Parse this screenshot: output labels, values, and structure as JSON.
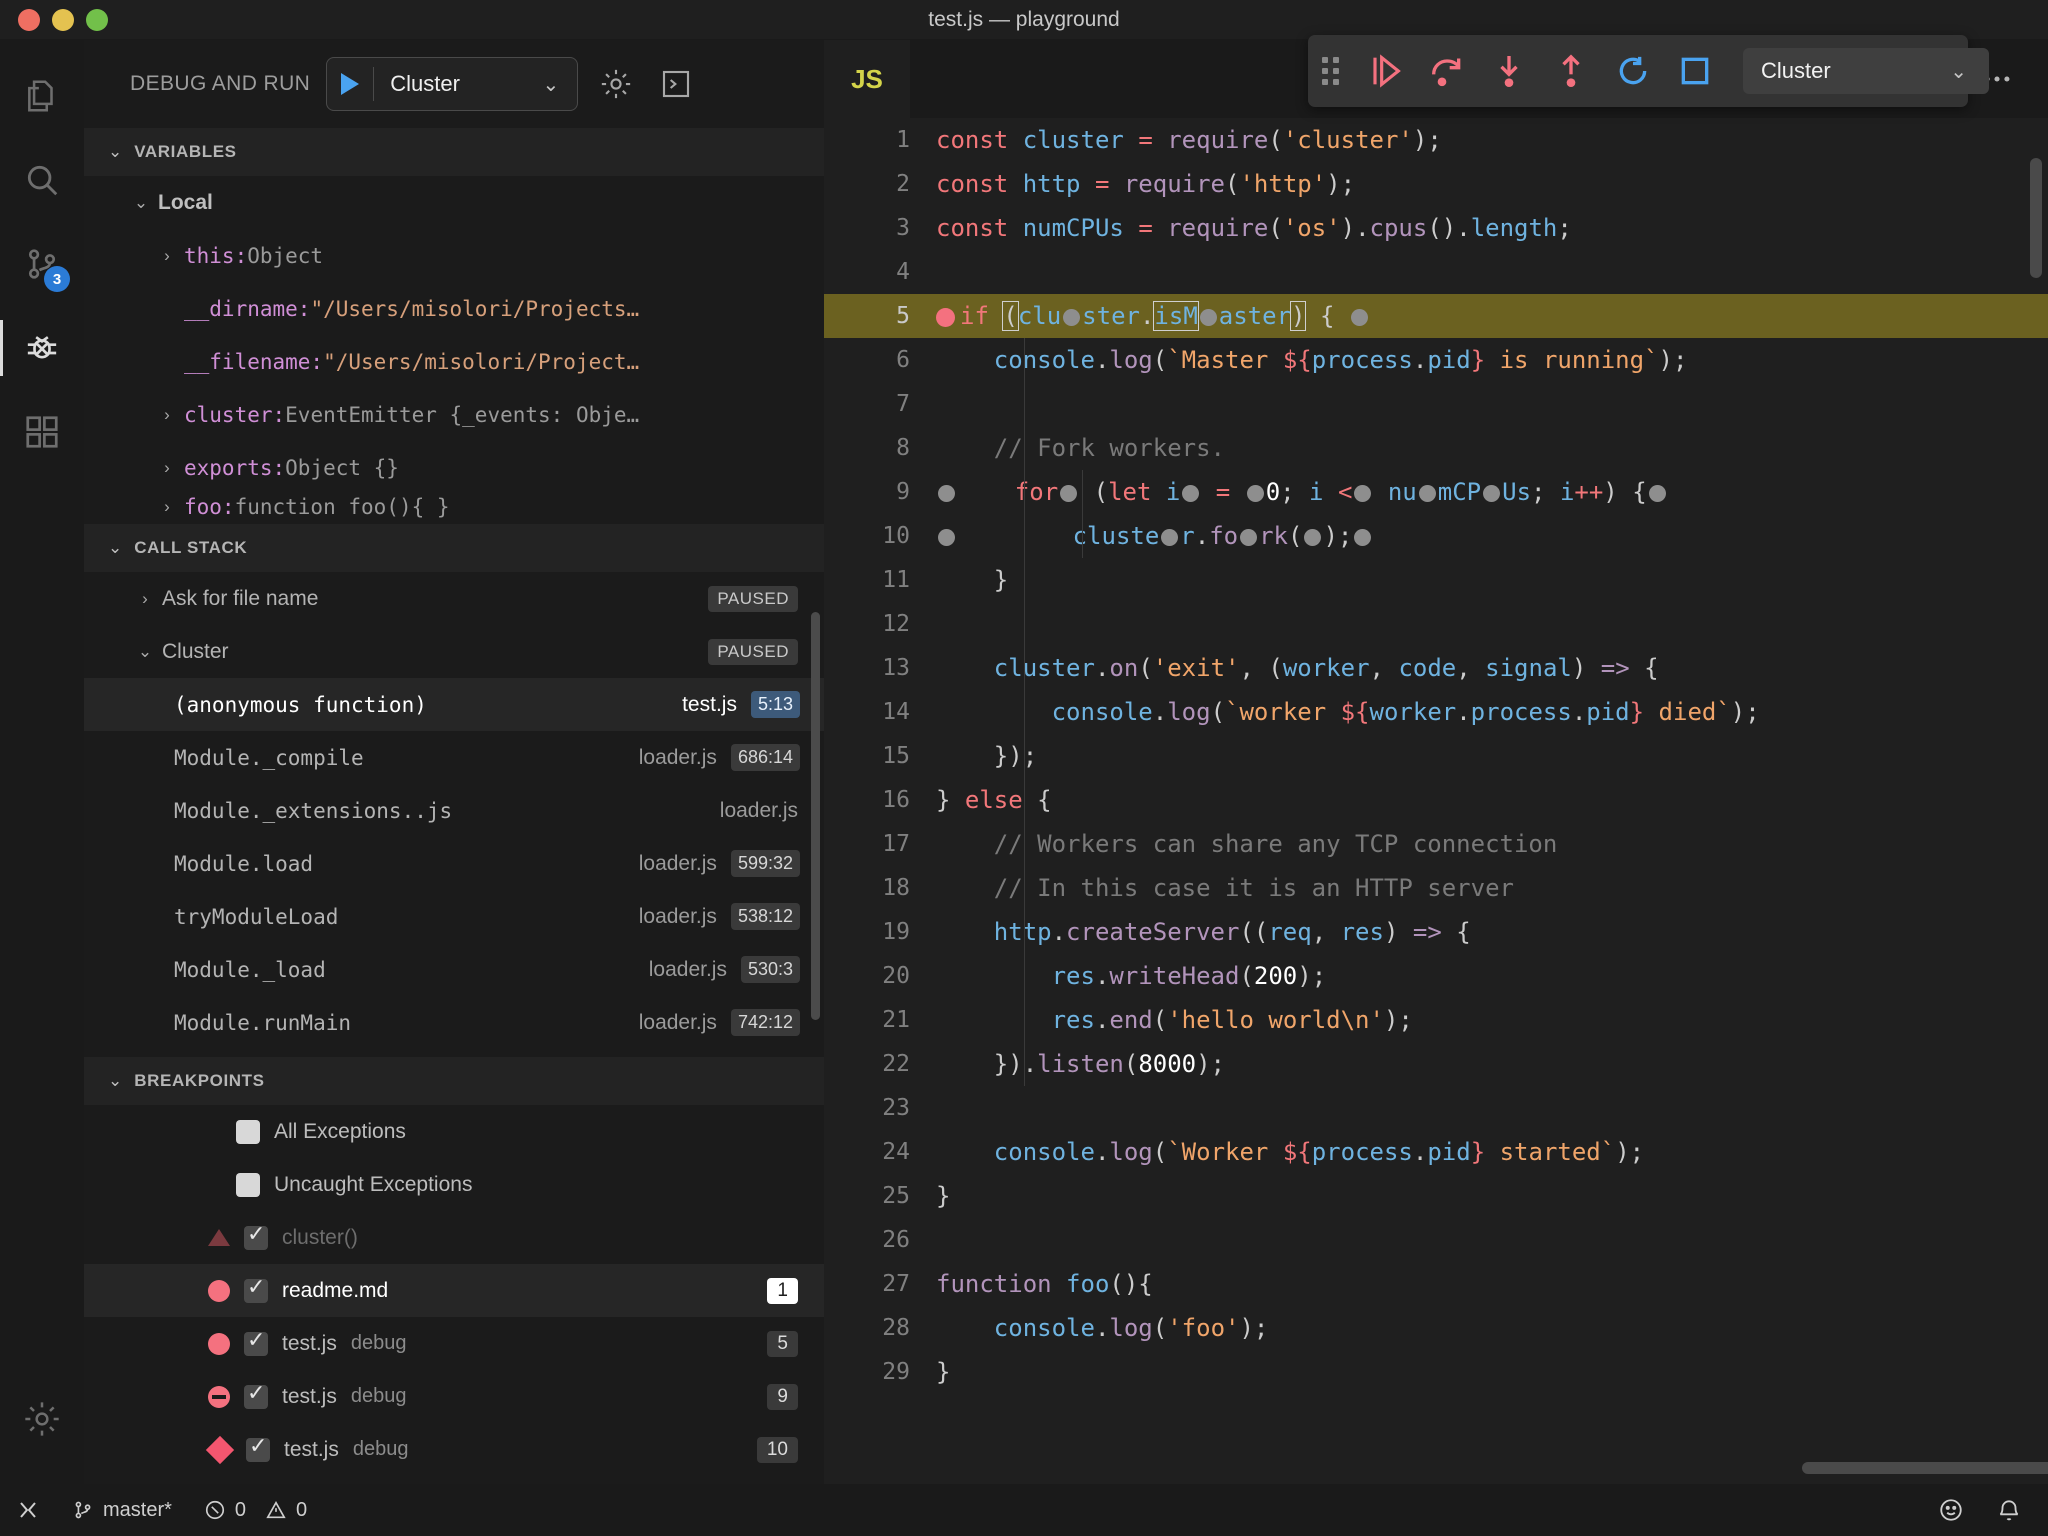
{
  "window": {
    "title": "test.js — playground"
  },
  "activity_bar": {
    "items": [
      {
        "name": "explorer-icon",
        "label": "Explorer"
      },
      {
        "name": "search-icon",
        "label": "Search"
      },
      {
        "name": "source-control-icon",
        "label": "Source Control",
        "badge": "3"
      },
      {
        "name": "run-debug-icon",
        "label": "Run and Debug",
        "active": true
      },
      {
        "name": "extensions-icon",
        "label": "Extensions"
      },
      {
        "name": "manage-gear-icon",
        "label": "Manage"
      }
    ]
  },
  "sidebar": {
    "title": "DEBUG AND RUN",
    "configuration": {
      "value": "Cluster",
      "play_label": "Start Debugging"
    },
    "gear_label": "Open launch.json",
    "terminal_label": "Debug Console",
    "variables": {
      "header": "VARIABLES",
      "scope": "Local",
      "items": [
        {
          "expand": "collapsed",
          "name": "this:",
          "value": " Object",
          "value_kind": "type"
        },
        {
          "expand": "none",
          "name": "__dirname:",
          "value": " \"/Users/misolori/Projects…",
          "value_kind": "string"
        },
        {
          "expand": "none",
          "name": "__filename:",
          "value": " \"/Users/misolori/Project…",
          "value_kind": "string"
        },
        {
          "expand": "collapsed",
          "name": "cluster:",
          "value": " EventEmitter {_events: Obje…",
          "value_kind": "type"
        },
        {
          "expand": "collapsed",
          "name": "exports:",
          "value": " Object {}",
          "value_kind": "type"
        },
        {
          "expand": "collapsed",
          "name": "foo:",
          "value": " function foo(){   }",
          "value_kind": "type"
        }
      ]
    },
    "call_stack": {
      "header": "CALL STACK",
      "sessions": [
        {
          "label": "Ask for file name",
          "state": "PAUSED",
          "expanded": false
        },
        {
          "label": "Cluster",
          "state": "PAUSED",
          "expanded": true
        }
      ],
      "frames": [
        {
          "name": "(anonymous function)",
          "file": "test.js",
          "pos": "5:13",
          "selected": true
        },
        {
          "name": "Module._compile",
          "file": "loader.js",
          "pos": "686:14",
          "selected": false
        },
        {
          "name": "Module._extensions..js",
          "file": "loader.js",
          "pos": "",
          "selected": false
        },
        {
          "name": "Module.load",
          "file": "loader.js",
          "pos": "599:32",
          "selected": false
        },
        {
          "name": "tryModuleLoad",
          "file": "loader.js",
          "pos": "538:12",
          "selected": false
        },
        {
          "name": "Module._load",
          "file": "loader.js",
          "pos": "530:3",
          "selected": false
        },
        {
          "name": "Module.runMain",
          "file": "loader.js",
          "pos": "742:12",
          "selected": false
        }
      ]
    },
    "breakpoints": {
      "header": "BREAKPOINTS",
      "items": [
        {
          "marker": "none",
          "checked": false,
          "label": "All Exceptions",
          "sub": "",
          "num": "",
          "selected": false,
          "dim": false
        },
        {
          "marker": "none",
          "checked": false,
          "label": "Uncaught Exceptions",
          "sub": "",
          "num": "",
          "selected": false,
          "dim": false
        },
        {
          "marker": "triangle",
          "checked": true,
          "label": "cluster()",
          "sub": "",
          "num": "",
          "selected": false,
          "dim": true
        },
        {
          "marker": "dot",
          "checked": true,
          "label": "readme.md",
          "sub": "",
          "num": "1",
          "selected": true,
          "dim": false
        },
        {
          "marker": "dot",
          "checked": true,
          "label": "test.js",
          "sub": "debug",
          "num": "5",
          "selected": false,
          "dim": false
        },
        {
          "marker": "conditional",
          "checked": true,
          "label": "test.js",
          "sub": "debug",
          "num": "9",
          "selected": false,
          "dim": false
        },
        {
          "marker": "diamond",
          "checked": true,
          "label": "test.js",
          "sub": "debug",
          "num": "10",
          "selected": false,
          "dim": false
        }
      ]
    }
  },
  "editor": {
    "tab": {
      "icon_label": "JS",
      "file": "test.js"
    },
    "tab_actions": [
      {
        "name": "split-compare-icon"
      },
      {
        "name": "split-editor-icon"
      },
      {
        "name": "more-actions-icon"
      }
    ],
    "debug_toolbar": {
      "grip_label": "Drag toolbar",
      "buttons": [
        {
          "name": "continue-button",
          "label": "Continue"
        },
        {
          "name": "step-over-button",
          "label": "Step Over"
        },
        {
          "name": "step-into-button",
          "label": "Step Into"
        },
        {
          "name": "step-out-button",
          "label": "Step Out"
        },
        {
          "name": "restart-button",
          "label": "Restart"
        },
        {
          "name": "stop-button",
          "label": "Stop"
        }
      ],
      "session": "Cluster"
    },
    "line_numbers": [
      1,
      2,
      3,
      4,
      5,
      6,
      7,
      8,
      9,
      10,
      11,
      12,
      13,
      14,
      15,
      16,
      17,
      18,
      19,
      20,
      21,
      22,
      23,
      24,
      25,
      26,
      27,
      28,
      29
    ],
    "current_line": 5,
    "code": [
      "const cluster = require('cluster');",
      "const http = require('http');",
      "const numCPUs = require('os').cpus().length;",
      "",
      "if (cluster.isMaster) {",
      "    console.log(`Master ${process.pid} is running`);",
      "",
      "    // Fork workers.",
      "    for (let i = 0; i < numCPUs; i++) {",
      "        cluster.fork();",
      "    }",
      "",
      "    cluster.on('exit', (worker, code, signal) => {",
      "        console.log(`worker ${worker.process.pid} died`);",
      "    });",
      "} else {",
      "    // Workers can share any TCP connection",
      "    // In this case it is an HTTP server",
      "    http.createServer((req, res) => {",
      "        res.writeHead(200);",
      "        res.end('hello world\\n');",
      "    }).listen(8000);",
      "",
      "    console.log(`Worker ${process.pid} started`);",
      "}",
      "",
      "function foo(){",
      "    console.log('foo');",
      "}"
    ]
  },
  "status_bar": {
    "remote_label": "",
    "branch": "master*",
    "errors": "0",
    "warnings": "0",
    "feedback_label": "Tweet Feedback",
    "notifications_label": "No Notifications"
  },
  "colors": {
    "accent_blue": "#4aa3f0",
    "debug_red": "#f4717f",
    "highlight_line": "#6b6120",
    "badge_blue": "#3d5a7a"
  }
}
